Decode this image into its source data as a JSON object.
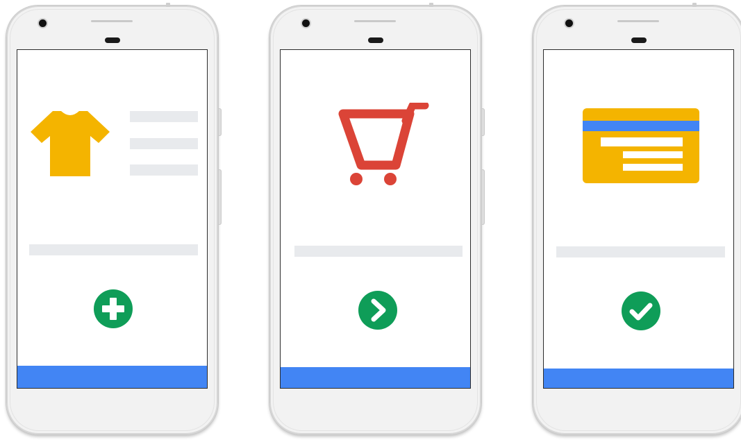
{
  "colors": {
    "brand_blue": "#4285f4",
    "accent_green": "#0f9d58",
    "shirt_yellow": "#f4b400",
    "cart_red": "#db4437",
    "placeholder_gray": "#e8eaed",
    "phone_body": "#f2f2f2"
  },
  "phones": [
    {
      "step": "add-item",
      "illustration_icon": "tshirt-icon",
      "action_icon": "plus-icon"
    },
    {
      "step": "proceed",
      "illustration_icon": "shopping-cart-icon",
      "action_icon": "chevron-right-icon"
    },
    {
      "step": "confirm-payment",
      "illustration_icon": "credit-card-icon",
      "action_icon": "checkmark-icon"
    }
  ]
}
